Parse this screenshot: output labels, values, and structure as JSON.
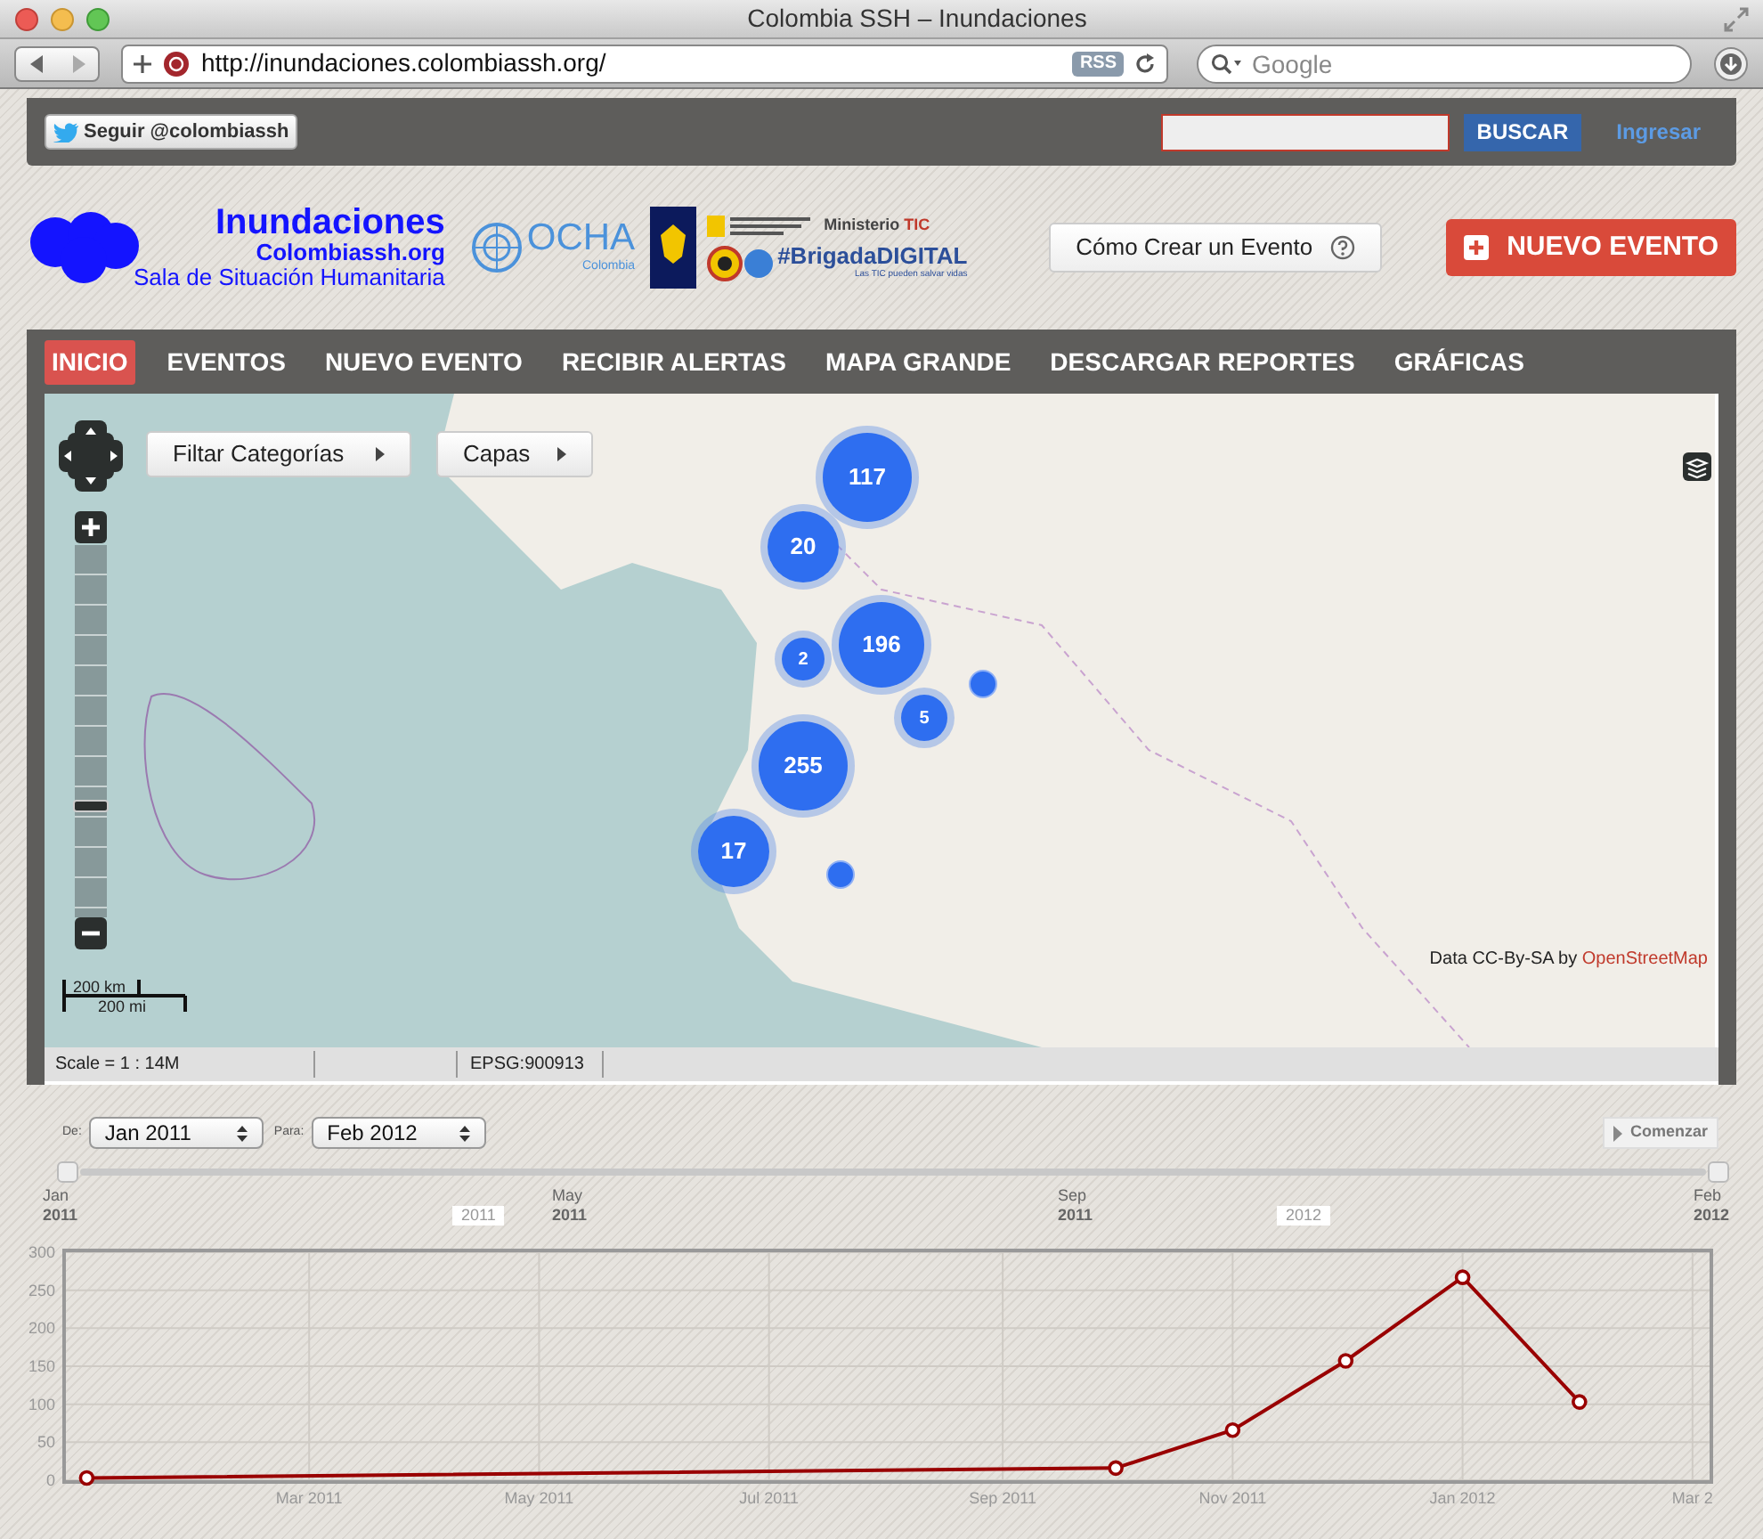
{
  "window": {
    "title": "Colombia SSH – Inundaciones"
  },
  "toolbar": {
    "url": "http://inundaciones.colombiassh.org/",
    "rss": "RSS",
    "search": {
      "placeholder": "Google"
    }
  },
  "top_bar": {
    "twitter_button": "Seguir @colombiassh",
    "search_button": "BUSCAR",
    "login_link": "Ingresar"
  },
  "header": {
    "logo": {
      "title": "Inundaciones",
      "subtitle": "Colombiassh.org",
      "tagline": "Sala de Situación Humanitaria"
    },
    "partners": {
      "ocha": "OCHA",
      "ocha_country": "Colombia",
      "ministry": "Ministerio",
      "ministry_tic": "TIC",
      "brigada": "#BrigadaDIGITAL",
      "brigada_slogan": "Las TIC pueden salvar vidas"
    },
    "help_button": "Cómo Crear un Evento",
    "new_event_button": "NUEVO EVENTO"
  },
  "nav": [
    {
      "label": "INICIO",
      "selected": true
    },
    {
      "label": "EVENTOS",
      "selected": false
    },
    {
      "label": "NUEVO EVENTO",
      "selected": false
    },
    {
      "label": "RECIBIR ALERTAS",
      "selected": false
    },
    {
      "label": "MAPA GRANDE",
      "selected": false
    },
    {
      "label": "DESCARGAR REPORTES",
      "selected": false
    },
    {
      "label": "GRÁFICAS",
      "selected": false
    }
  ],
  "map": {
    "filter_button": "Filtar Categorías",
    "layers_button": "Capas",
    "zoom": {
      "level": 0.3
    },
    "markers": [
      {
        "kind": "cluster",
        "count": "117"
      },
      {
        "kind": "cluster",
        "count": "20"
      },
      {
        "kind": "cluster",
        "count": "2"
      },
      {
        "kind": "cluster",
        "count": "196"
      },
      {
        "kind": "cluster",
        "count": "5"
      },
      {
        "kind": "cluster",
        "count": "255"
      },
      {
        "kind": "cluster",
        "count": "17"
      },
      {
        "kind": "point"
      },
      {
        "kind": "point"
      }
    ],
    "scale": {
      "km": "200 km",
      "mi": "200 mi"
    },
    "attribution": {
      "text": "Data CC-By-SA by",
      "link": "OpenStreetMap"
    }
  },
  "status_bar": {
    "scale": "Scale = 1 : 14M",
    "projection": "EPSG:900913"
  },
  "timeline": {
    "from_label": "De:",
    "from": "Jan 2011",
    "to_label": "Para:",
    "to": "Feb 2012",
    "play_button": "Comenzar",
    "ticks": [
      {
        "month": "Jan",
        "year": "2011"
      },
      {
        "month": "May",
        "year": "2011"
      },
      {
        "month": "Sep",
        "year": "2011"
      },
      {
        "month": "Feb",
        "year": "2012"
      }
    ],
    "year_badges": [
      "2011",
      "2012"
    ],
    "chart_data": {
      "type": "line",
      "x": [
        "2011-01-01",
        "2011-10-01",
        "2011-11-01",
        "2011-12-01",
        "2012-01-01",
        "2012-02-01"
      ],
      "grid": true,
      "series": [
        {
          "color": "#990000",
          "marker": "circle",
          "values": [
            3,
            16,
            66,
            157,
            267,
            103
          ]
        }
      ],
      "xlim": [
        "2010-12-26",
        "2012-03-07"
      ],
      "ylim": [
        0,
        300
      ],
      "xticks": [
        {
          "value": "2011-03-01",
          "label": "Mar 2011"
        },
        {
          "value": "2011-05-01",
          "label": "May 2011"
        },
        {
          "value": "2011-07-01",
          "label": "Jul 2011"
        },
        {
          "value": "2011-09-01",
          "label": "Sep 2011"
        },
        {
          "value": "2011-11-01",
          "label": "Nov 2011"
        },
        {
          "value": "2012-01-01",
          "label": "Jan 2012"
        },
        {
          "value": "2012-03-02",
          "label": "Mar 2"
        }
      ],
      "yticks": [
        0,
        50,
        100,
        150,
        200,
        250,
        300
      ]
    }
  }
}
